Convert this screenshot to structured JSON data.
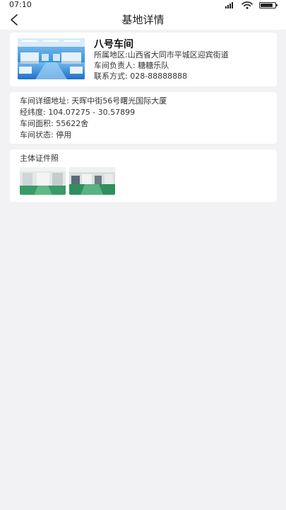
{
  "status_bar": {
    "time": "07:10",
    "battery_level": 0.85
  },
  "nav": {
    "back_icon": "chevron-left-icon",
    "title": "基地详情"
  },
  "summary": {
    "name": "八号车间",
    "region": "所属地区:山西省大同市平城区迎宾街道",
    "manager": "车间负责人:  糖糖乐队",
    "contact": "联系方式:  028-88888888"
  },
  "details": {
    "address": "车间详细地址:  天晖中街56号曙光国际大厦",
    "coordinates": "经纬度:  104.07275 - 30.57899",
    "area": "车间面积:  55622舍",
    "status": "车间状态:  停用"
  },
  "license": {
    "title": "主体证件照"
  },
  "colors": {
    "background": "#f2f2f4",
    "card": "#ffffff",
    "text": "#333333"
  }
}
